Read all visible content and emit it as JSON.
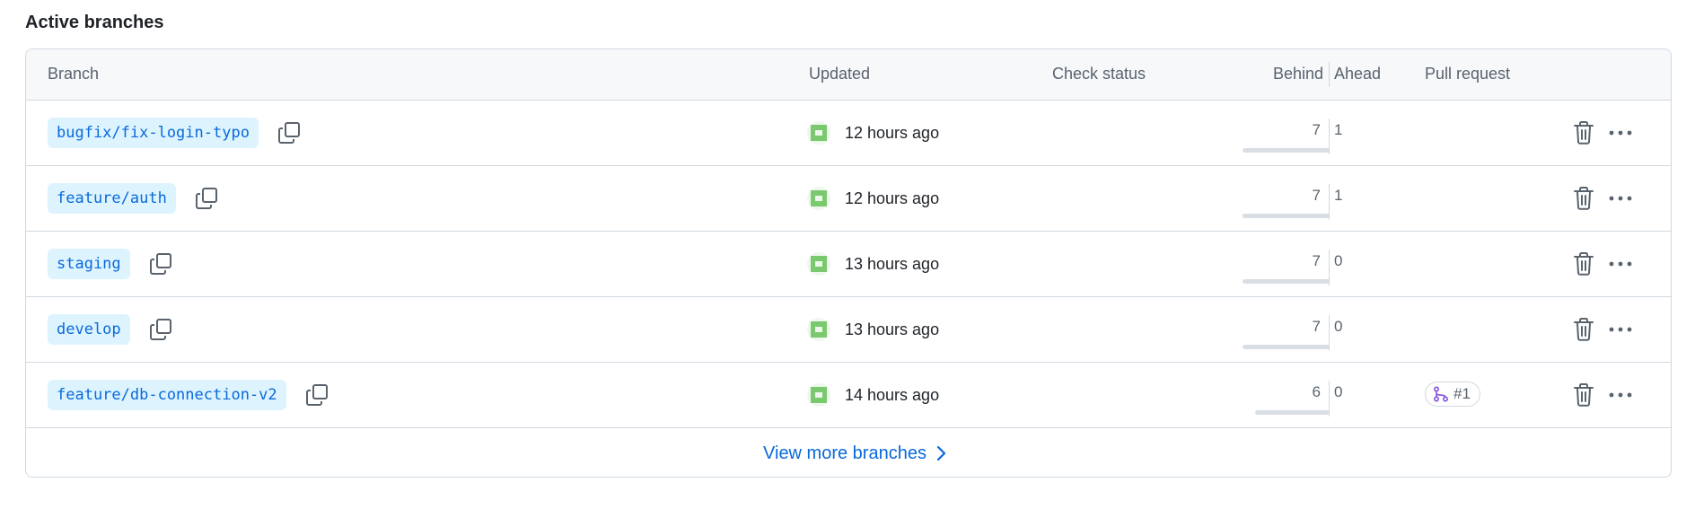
{
  "section": {
    "title": "Active branches"
  },
  "columns": {
    "branch": "Branch",
    "updated": "Updated",
    "check_status": "Check status",
    "behind": "Behind",
    "ahead": "Ahead",
    "pull_request": "Pull request"
  },
  "rows": [
    {
      "branch": "bugfix/fix-login-typo",
      "updated": "12 hours ago",
      "behind": "7",
      "ahead": "1",
      "pr": ""
    },
    {
      "branch": "feature/auth",
      "updated": "12 hours ago",
      "behind": "7",
      "ahead": "1",
      "pr": ""
    },
    {
      "branch": "staging",
      "updated": "13 hours ago",
      "behind": "7",
      "ahead": "0",
      "pr": ""
    },
    {
      "branch": "develop",
      "updated": "13 hours ago",
      "behind": "7",
      "ahead": "0",
      "pr": ""
    },
    {
      "branch": "feature/db-connection-v2",
      "updated": "14 hours ago",
      "behind": "6",
      "ahead": "0",
      "pr": "#1"
    }
  ],
  "footer": {
    "view_more": "View more branches"
  },
  "icons": {
    "copy": "copy-icon",
    "trash": "trash-icon",
    "more": "kebab-horizontal-icon",
    "pr": "git-pull-request-icon",
    "chevron": "chevron-right-icon"
  },
  "colors": {
    "accent": "#0969da",
    "chip_bg": "#ddf4ff",
    "pr_icon": "#8250df",
    "avatar": "#7bc96f"
  }
}
